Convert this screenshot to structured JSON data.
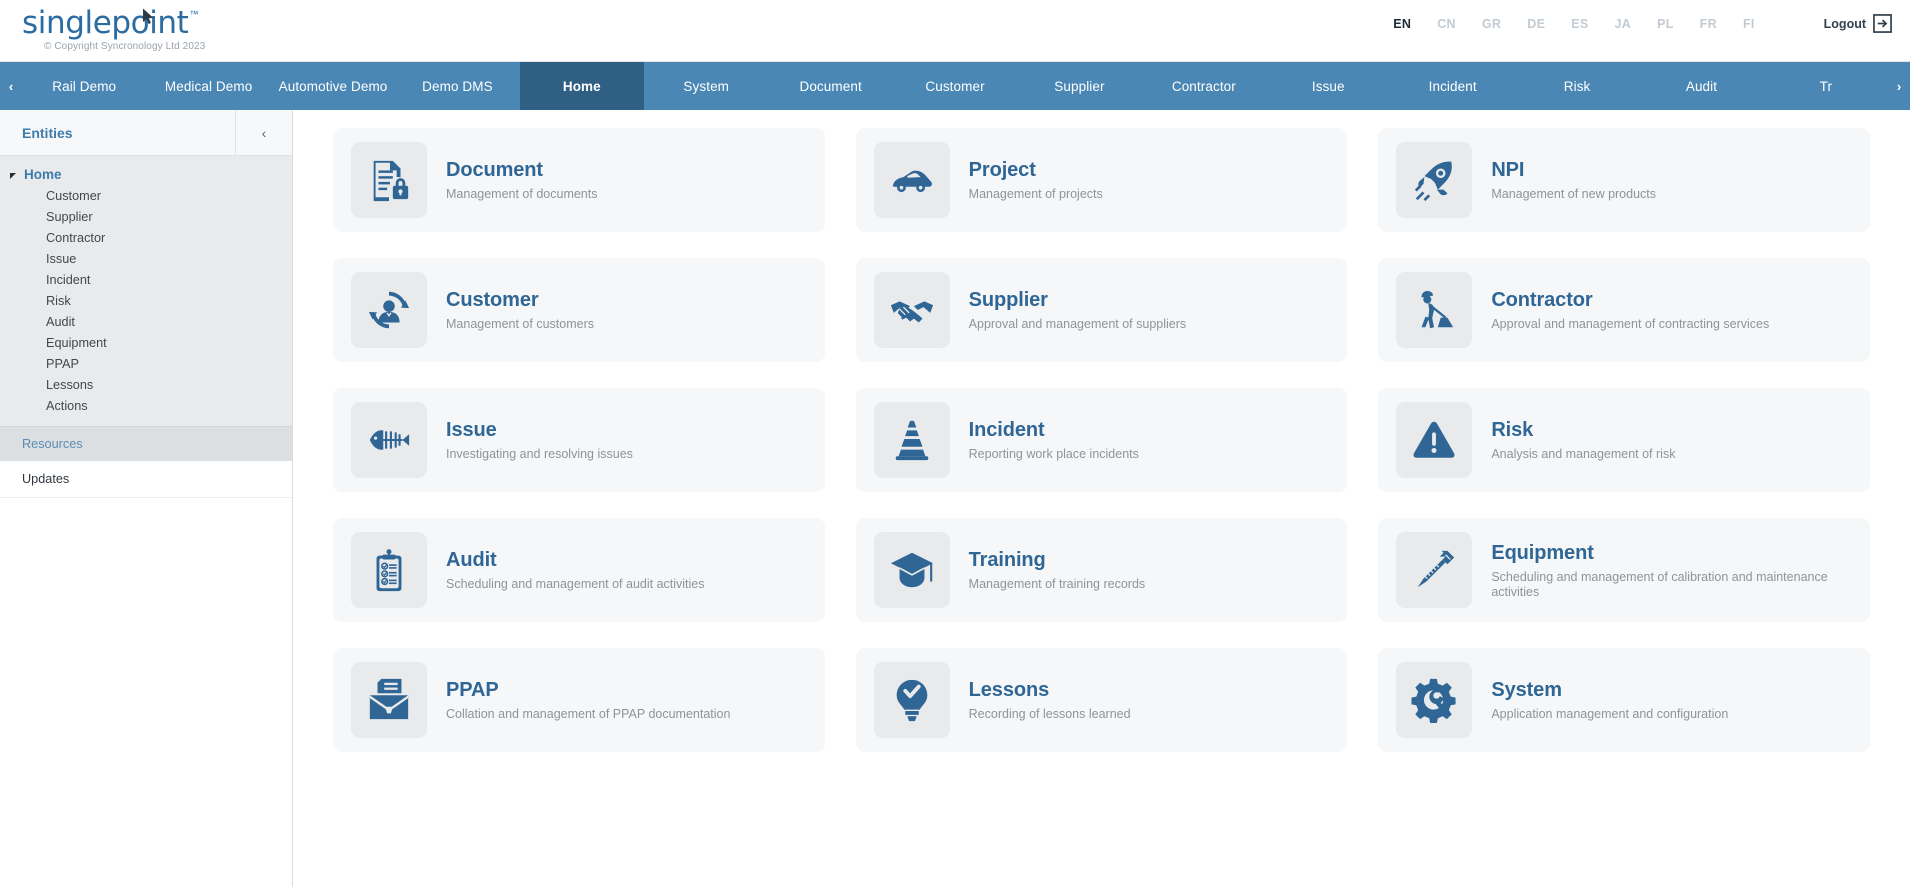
{
  "header": {
    "logo_text": "singlepoint",
    "logo_tm": "™",
    "copyright": "© Copyright Syncronology Ltd 2023",
    "languages": [
      {
        "code": "EN",
        "active": true
      },
      {
        "code": "CN",
        "active": false
      },
      {
        "code": "GR",
        "active": false
      },
      {
        "code": "DE",
        "active": false
      },
      {
        "code": "ES",
        "active": false
      },
      {
        "code": "JA",
        "active": false
      },
      {
        "code": "PL",
        "active": false
      },
      {
        "code": "FR",
        "active": false
      },
      {
        "code": "FI",
        "active": false
      }
    ],
    "logout_label": "Logout"
  },
  "navbar": {
    "scroll_left": "‹",
    "scroll_right": "›",
    "items": [
      {
        "label": "Rail Demo",
        "active": false
      },
      {
        "label": "Medical Demo",
        "active": false
      },
      {
        "label": "Automotive Demo",
        "active": false
      },
      {
        "label": "Demo DMS",
        "active": false
      },
      {
        "label": "Home",
        "active": true
      },
      {
        "label": "System",
        "active": false
      },
      {
        "label": "Document",
        "active": false
      },
      {
        "label": "Customer",
        "active": false
      },
      {
        "label": "Supplier",
        "active": false
      },
      {
        "label": "Contractor",
        "active": false
      },
      {
        "label": "Issue",
        "active": false
      },
      {
        "label": "Incident",
        "active": false
      },
      {
        "label": "Risk",
        "active": false
      },
      {
        "label": "Audit",
        "active": false
      },
      {
        "label": "Tr",
        "active": false
      }
    ]
  },
  "sidebar": {
    "title": "Entities",
    "collapse_icon": "‹",
    "tree": {
      "root_label": "Home",
      "children": [
        {
          "label": "Customer"
        },
        {
          "label": "Supplier"
        },
        {
          "label": "Contractor"
        },
        {
          "label": "Issue"
        },
        {
          "label": "Incident"
        },
        {
          "label": "Risk"
        },
        {
          "label": "Audit"
        },
        {
          "label": "Equipment"
        },
        {
          "label": "PPAP"
        },
        {
          "label": "Lessons"
        },
        {
          "label": "Actions"
        }
      ]
    },
    "sections": [
      {
        "label": "Resources",
        "type": "head"
      },
      {
        "label": "Updates",
        "type": "item"
      }
    ]
  },
  "main": {
    "cards": [
      {
        "icon": "document-lock-icon",
        "title": "Document",
        "subtitle": "Management of documents"
      },
      {
        "icon": "car-icon",
        "title": "Project",
        "subtitle": "Management of projects"
      },
      {
        "icon": "rocket-icon",
        "title": "NPI",
        "subtitle": "Management of new products"
      },
      {
        "icon": "customer-cycle-icon",
        "title": "Customer",
        "subtitle": "Management of customers"
      },
      {
        "icon": "handshake-icon",
        "title": "Supplier",
        "subtitle": "Approval and management of suppliers"
      },
      {
        "icon": "worker-digging-icon",
        "title": "Contractor",
        "subtitle": "Approval and management of contracting services"
      },
      {
        "icon": "fishbone-icon",
        "title": "Issue",
        "subtitle": "Investigating and resolving issues"
      },
      {
        "icon": "traffic-cone-icon",
        "title": "Incident",
        "subtitle": "Reporting work place incidents"
      },
      {
        "icon": "warning-triangle-icon",
        "title": "Risk",
        "subtitle": "Analysis and management of risk"
      },
      {
        "icon": "clipboard-check-icon",
        "title": "Audit",
        "subtitle": "Scheduling and management of audit activities"
      },
      {
        "icon": "graduation-cap-icon",
        "title": "Training",
        "subtitle": "Management of training records"
      },
      {
        "icon": "caliper-icon",
        "title": "Equipment",
        "subtitle": "Scheduling and management of calibration and maintenance activities"
      },
      {
        "icon": "file-box-icon",
        "title": "PPAP",
        "subtitle": "Collation and management of PPAP documentation"
      },
      {
        "icon": "lightbulb-check-icon",
        "title": "Lessons",
        "subtitle": "Recording of lessons learned"
      },
      {
        "icon": "gear-wrench-icon",
        "title": "System",
        "subtitle": "Application management and configuration"
      }
    ]
  },
  "colors": {
    "brand_blue": "#2b6ca3",
    "nav_blue": "#4a87b5",
    "nav_active_blue": "#2f5f83",
    "icon_blue": "#2f6695",
    "card_bg": "#f6f7f8",
    "icon_tile_bg": "#e9eaec"
  }
}
